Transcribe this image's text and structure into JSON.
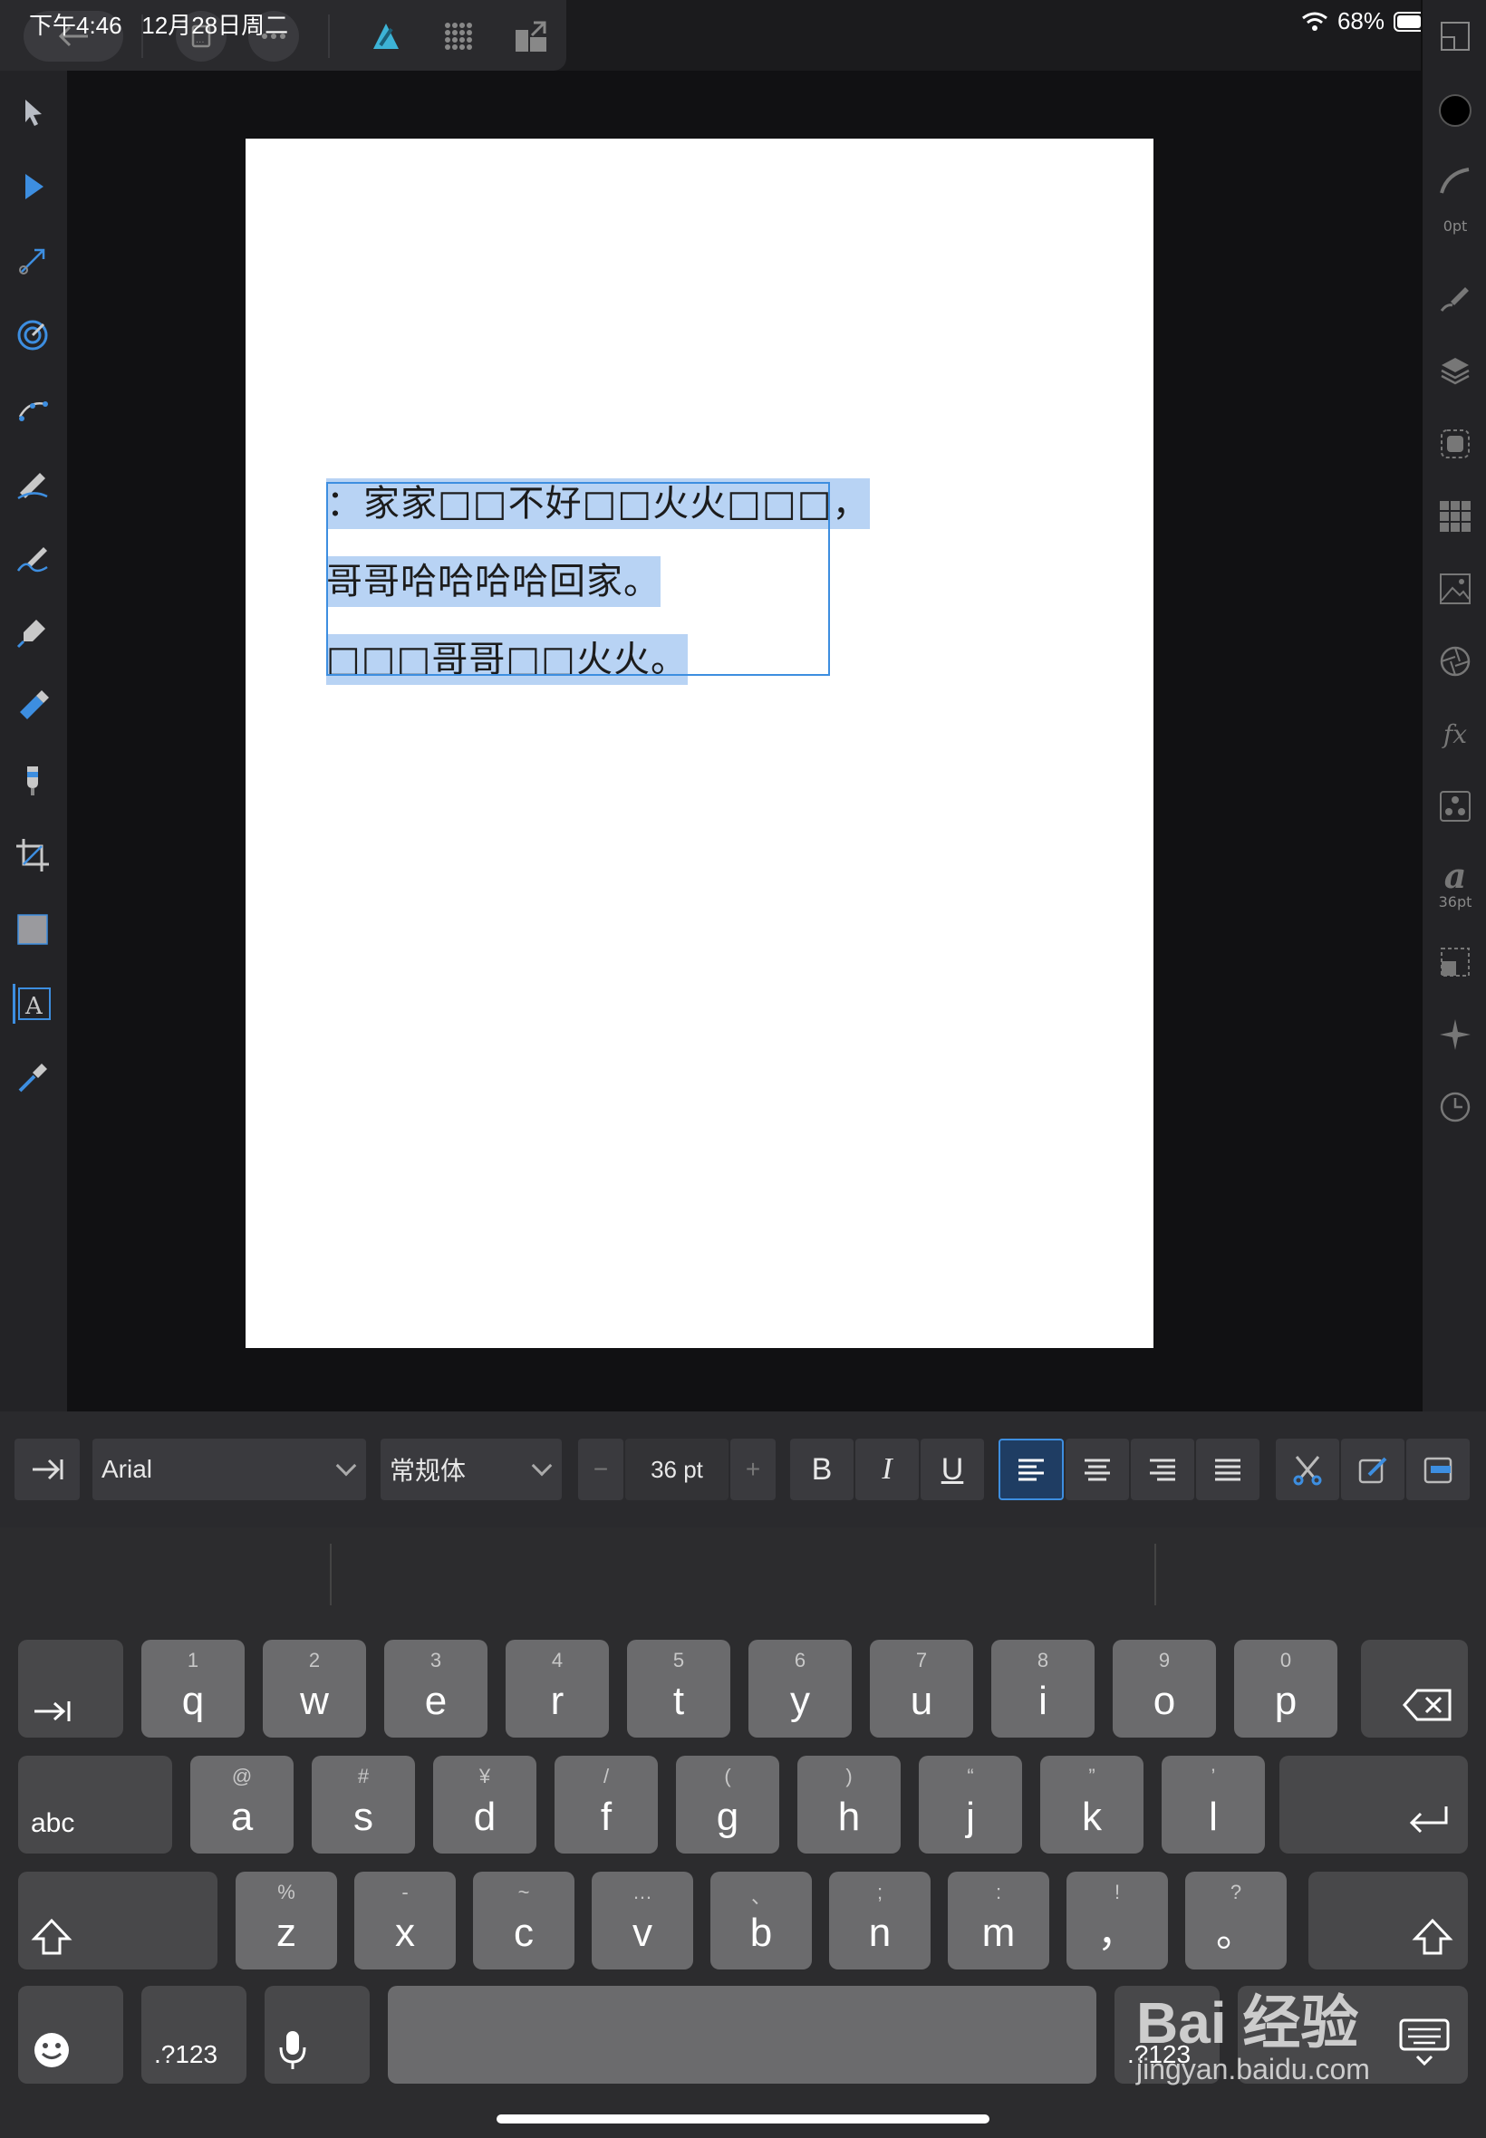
{
  "status": {
    "time": "下午4:46",
    "date": "12月28日周二",
    "battery": "68%"
  },
  "document": {
    "lines": [
      "：家家□□不好□□火火□□□，",
      "哥哥哈哈哈哈回家。",
      "□□□哥哥□□火火。"
    ]
  },
  "right_panel": {
    "stroke_label": "0pt",
    "text_size_label": "36pt",
    "text_glyph": "a",
    "fx_label": "fx"
  },
  "format_bar": {
    "font": "Arial",
    "style": "常规体",
    "size": "36 pt",
    "minus": "−",
    "plus": "+",
    "bold": "B",
    "italic": "I",
    "underline": "U"
  },
  "keyboard": {
    "row1": [
      {
        "sub": "1",
        "main": "q"
      },
      {
        "sub": "2",
        "main": "w"
      },
      {
        "sub": "3",
        "main": "e"
      },
      {
        "sub": "4",
        "main": "r"
      },
      {
        "sub": "5",
        "main": "t"
      },
      {
        "sub": "6",
        "main": "y"
      },
      {
        "sub": "7",
        "main": "u"
      },
      {
        "sub": "8",
        "main": "i"
      },
      {
        "sub": "9",
        "main": "o"
      },
      {
        "sub": "0",
        "main": "p"
      }
    ],
    "row2": [
      {
        "sub": "@",
        "main": "a"
      },
      {
        "sub": "#",
        "main": "s"
      },
      {
        "sub": "¥",
        "main": "d"
      },
      {
        "sub": "/",
        "main": "f"
      },
      {
        "sub": "(",
        "main": "g"
      },
      {
        "sub": ")",
        "main": "h"
      },
      {
        "sub": "“",
        "main": "j"
      },
      {
        "sub": "”",
        "main": "k"
      },
      {
        "sub": "’",
        "main": "l"
      }
    ],
    "row3": [
      {
        "sub": "%",
        "main": "z"
      },
      {
        "sub": "-",
        "main": "x"
      },
      {
        "sub": "~",
        "main": "c"
      },
      {
        "sub": "…",
        "main": "v"
      },
      {
        "sub": "、",
        "main": "b"
      },
      {
        "sub": ";",
        "main": "n"
      },
      {
        "sub": ":",
        "main": "m"
      },
      {
        "sub": "!",
        "main": "，"
      },
      {
        "sub": "?",
        "main": "。"
      }
    ],
    "abc_label": "abc",
    "num_label": ".?123",
    "num_label_right": ".?123"
  },
  "watermark": {
    "line1": "Bai 经验",
    "line2": "jingyan.baidu.com"
  },
  "colors": {
    "accent": "#3d8ee0",
    "selection": "#b8d3f4",
    "app_bg": "#1b1b1d"
  }
}
